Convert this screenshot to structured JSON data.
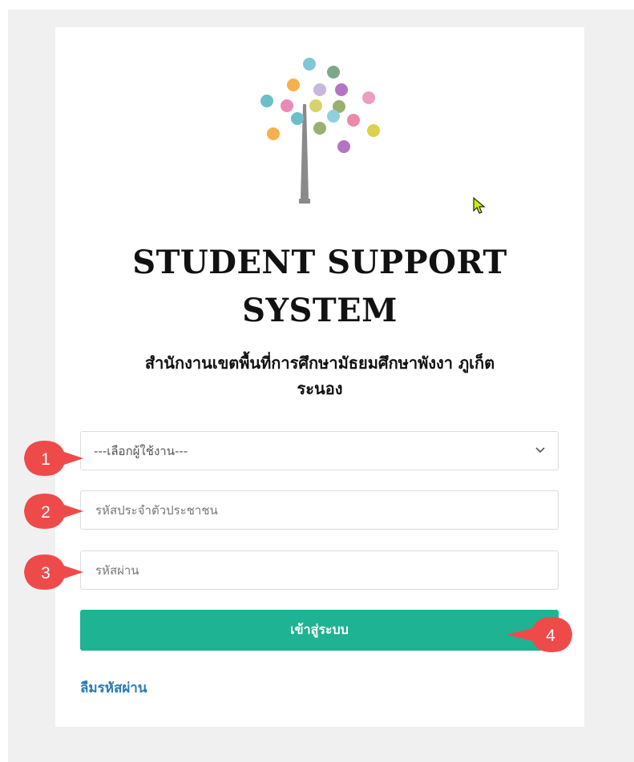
{
  "app": {
    "title_line1": "STUDENT SUPPORT",
    "title_line2": "SYSTEM",
    "subtitle_line1": "สำนักงานเขตพื้นที่การศึกษามัธยมศึกษาพังงา ภูเก็ต",
    "subtitle_line2": "ระนอง"
  },
  "form": {
    "user_select": {
      "selected": "---เลือกผู้ใช้งาน---",
      "icon": "chevron-down-icon"
    },
    "citizen_id": {
      "placeholder": "รหัสประจำตัวประชาชน",
      "value": ""
    },
    "password": {
      "placeholder": "รหัสผ่าน",
      "value": ""
    },
    "login_label": "เข้าสู่ระบบ",
    "forgot_label": "ลืมรหัสผ่าน"
  },
  "callouts": [
    "1",
    "2",
    "3",
    "4"
  ],
  "colors": {
    "accent": "#1eb392",
    "link": "#2a7ab8",
    "callout": "#ef4a4a",
    "background": "#f0f0f0"
  }
}
